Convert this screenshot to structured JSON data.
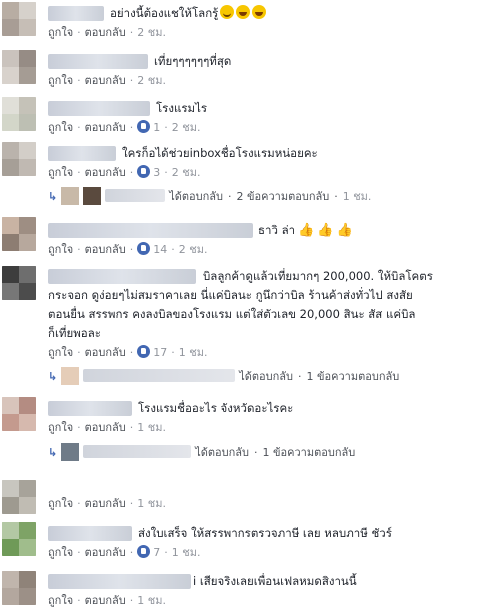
{
  "comments": [
    {
      "text": "อย่างนี้ต้องแชให้โลกรู้",
      "meta": {
        "like": "ถูกใจ",
        "reply": "ตอบกลับ",
        "time": "2 ชม."
      }
    },
    {
      "text": "เที่ยๆๆๆๆๆๆที่สุด",
      "meta": {
        "like": "ถูกใจ",
        "reply": "ตอบกลับ",
        "time": "2 ชม."
      }
    },
    {
      "text": "โรงแรมไร",
      "meta": {
        "like": "ถูกใจ",
        "reply": "ตอบกลับ",
        "likes": "1",
        "time": "2 ชม."
      }
    },
    {
      "text": "ใครก็อได้ช่วยinboxชื่อโรงแรมหน่อยคะ",
      "meta": {
        "like": "ถูกใจ",
        "reply": "ตอบกลับ",
        "likes": "3",
        "time": "2 ชม."
      },
      "replies": {
        "replied": "ได้ตอบกลับ",
        "count": "2 ข้อความตอบกลับ",
        "time": "1 ชม."
      }
    },
    {
      "text": "ธาวิ ล่า",
      "meta": {
        "like": "ถูกใจ",
        "reply": "ตอบกลับ",
        "likes": "14",
        "time": "2 ชม."
      }
    },
    {
      "text": "บิลลูกค้าดูแล้วเที่ยมากๆ 200,000. ให้บิลโคตร\nกระจอก ดูง่อยๆไม่สมราคาเลย นี่แค่บิลนะ กูนึกว่าบิล ร้านค้าส่งทั่วไป สงสัย\nตอนยื่น สรรพกร คงลงบิลของโรงแรม แต่ใส่ตัวเลข 20,000 สินะ สัส แค่บิล\nก็เที่ยพอละ",
      "meta": {
        "like": "ถูกใจ",
        "reply": "ตอบกลับ",
        "likes": "17",
        "time": "1 ชม."
      },
      "replies": {
        "replied": "ได้ตอบกลับ",
        "count": "1 ข้อความตอบกลับ"
      }
    },
    {
      "text": "โรงแรมชื่ออะไร จังหวัดอะไรคะ",
      "meta": {
        "like": "ถูกใจ",
        "reply": "ตอบกลับ",
        "time": "1 ชม."
      },
      "replies": {
        "replied": "ได้ตอบกลับ",
        "count": "1 ข้อความตอบกลับ"
      }
    },
    {
      "text": "",
      "meta": {
        "like": "ถูกใจ",
        "reply": "ตอบกลับ",
        "time": "1 ชม."
      }
    },
    {
      "text": "ส่งใบเสร็จ ให้สรรพากรตรวจภาษี เลย หลบภาษี ชัวร์",
      "meta": {
        "like": "ถูกใจ",
        "reply": "ตอบกลับ",
        "likes": "7",
        "time": "1 ชม."
      }
    },
    {
      "text": "i เสียจริงเลยเพื่อนเฟลหมดสิงานนี้",
      "meta": {
        "like": "ถูกใจ",
        "reply": "ตอบกลับ",
        "time": "1 ชม."
      }
    }
  ],
  "colors": {
    "link": "#4b4f56",
    "meta": "#90949c",
    "like_badge": "#4267b2",
    "reply_arrow": "#4267b2"
  }
}
